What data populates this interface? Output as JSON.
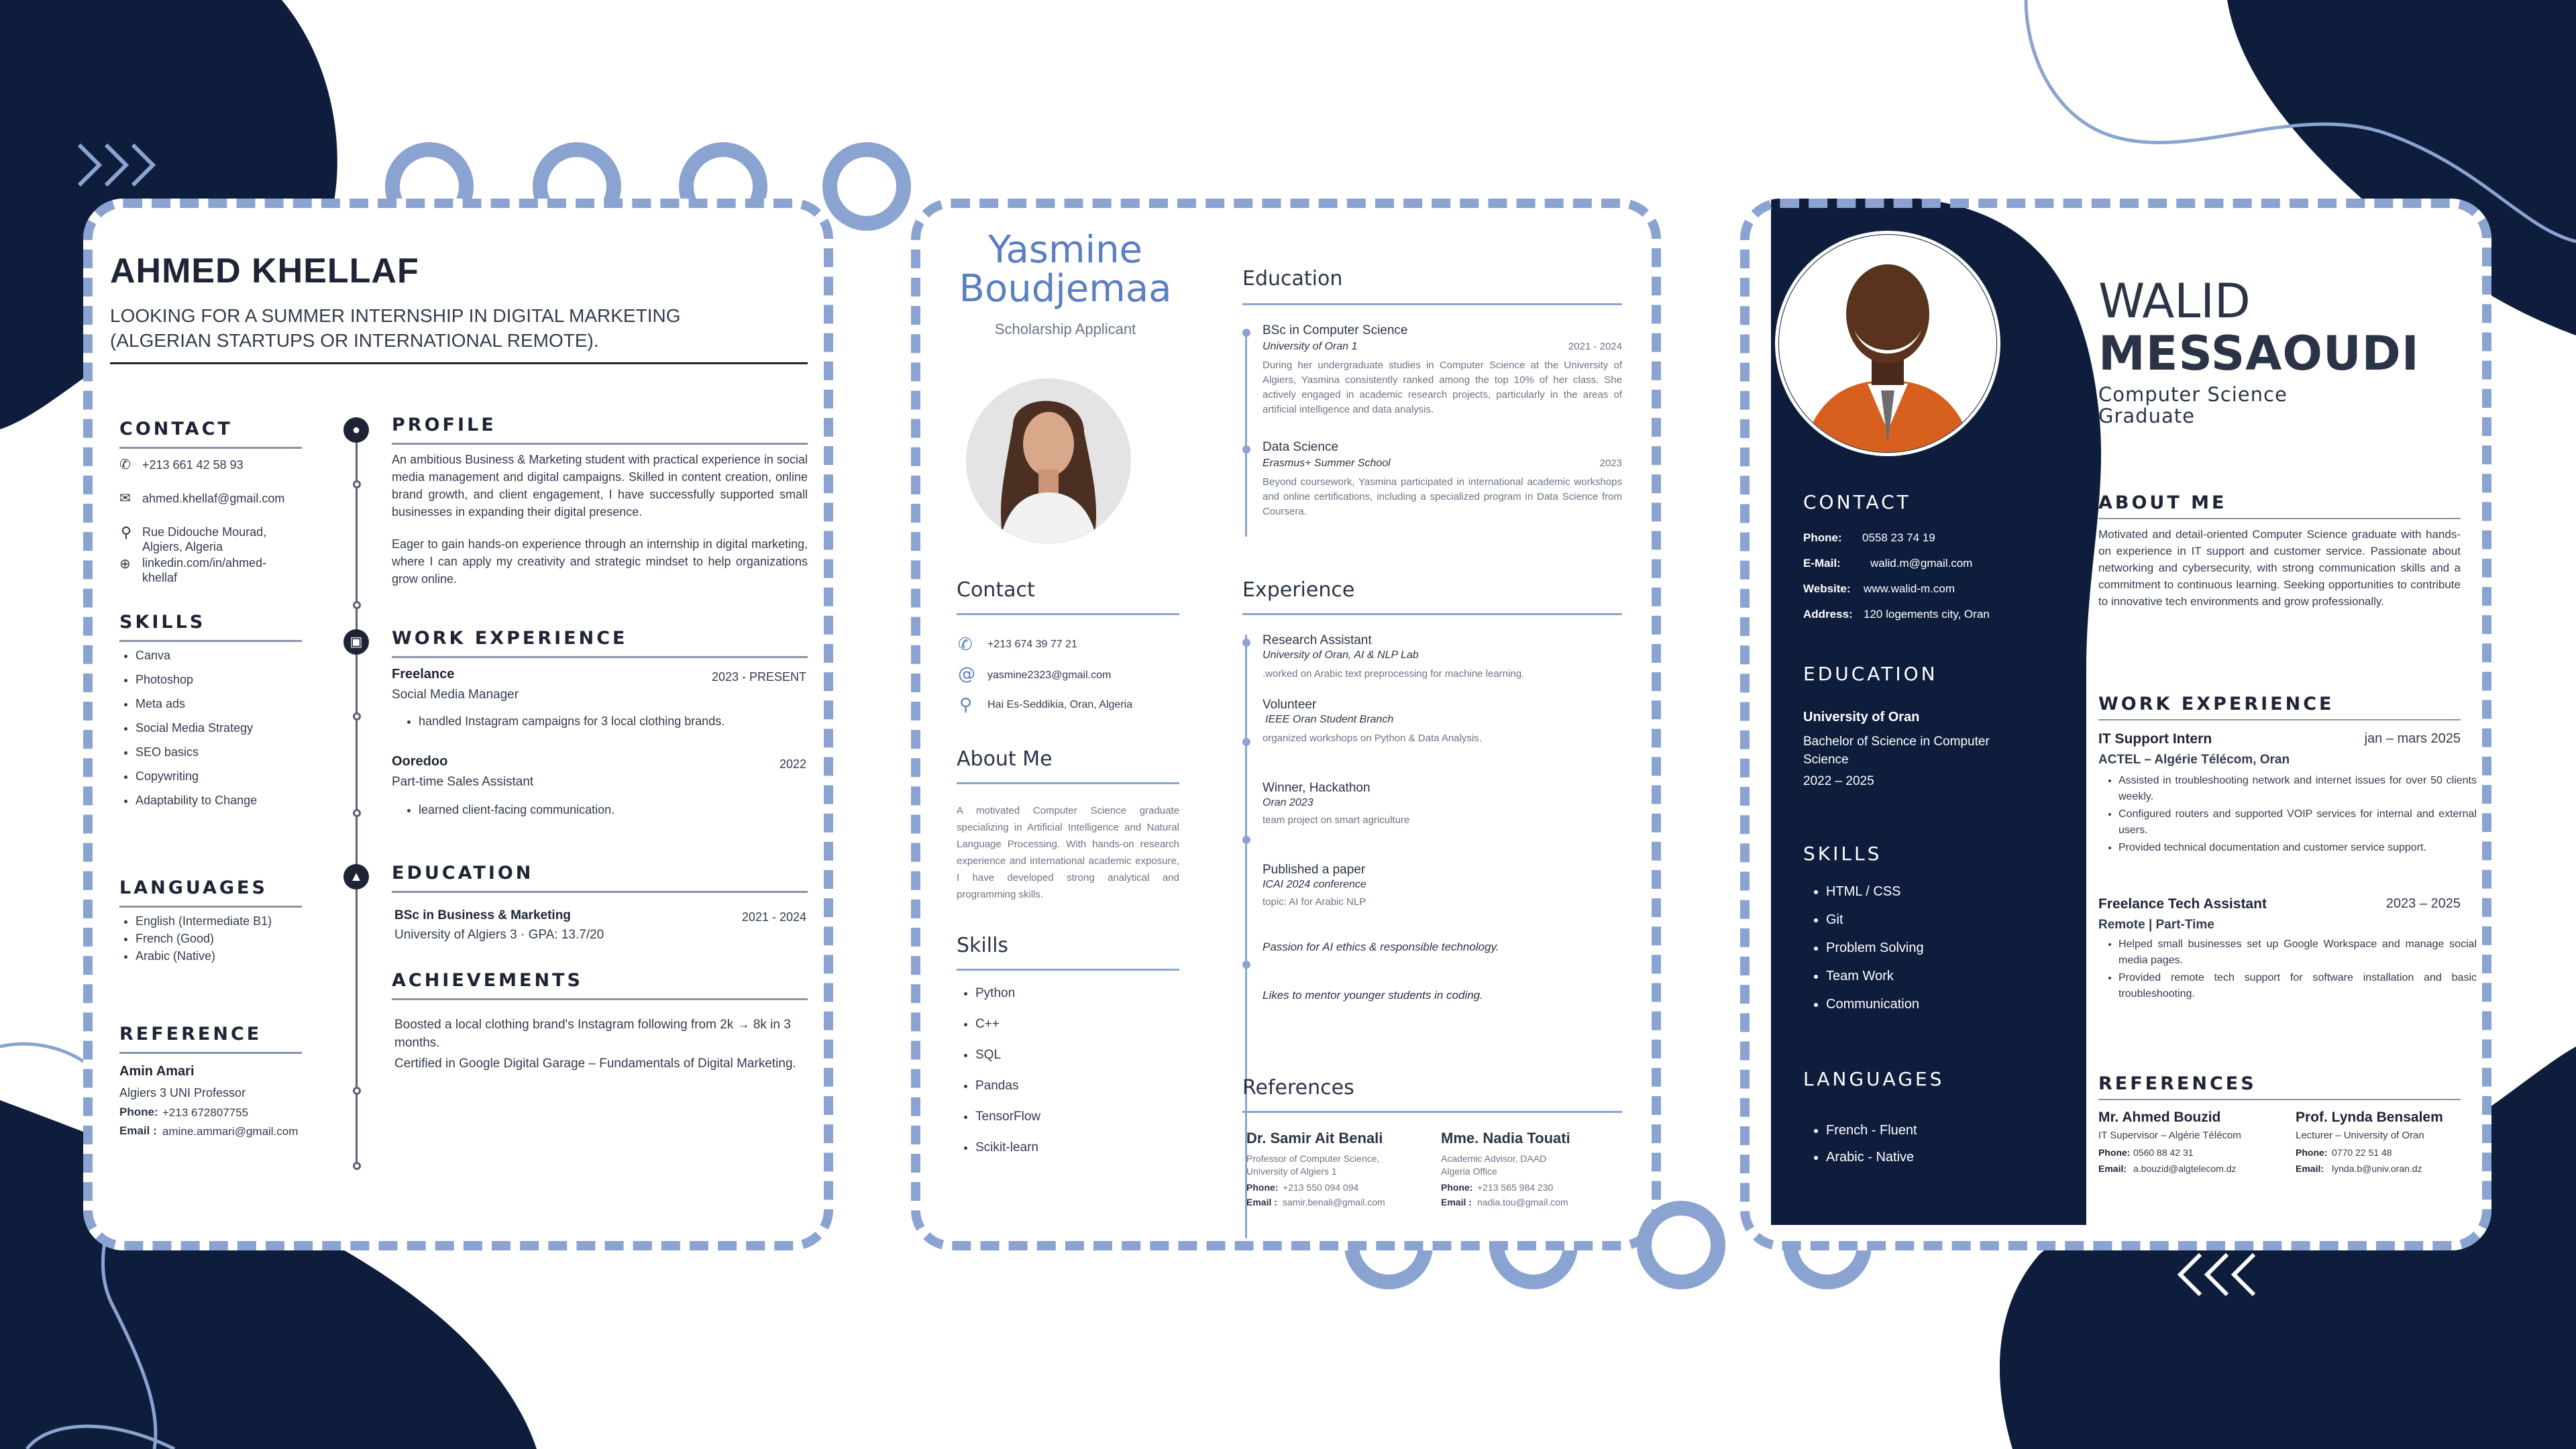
{
  "colors": {
    "navy": "#0f1d3d",
    "accent": "#8aa3d0",
    "blue": "#5b7fc0",
    "text": "#333b4d"
  },
  "cv1": {
    "name": "AHMED KHELLAF",
    "objective": "LOOKING FOR A SUMMER INTERNSHIP IN DIGITAL MARKETING (ALGERIAN STARTUPS OR INTERNATIONAL REMOTE).",
    "contact_title": "CONTACT",
    "contact": {
      "phone": "+213 661 42 58 93",
      "email": "ahmed.khellaf@gmail.com",
      "address": "Rue Didouche Mourad, Algiers, Algeria",
      "web": "linkedin.com/in/ahmed-khellaf"
    },
    "skills_title": "SKILLS",
    "skills": [
      "Canva",
      "Photoshop",
      "Meta ads",
      "Social Media Strategy",
      "SEO basics",
      "Copywriting",
      "Adaptability to Change"
    ],
    "languages_title": "LANGUAGES",
    "languages": [
      "English (Intermediate B1)",
      "French (Good)",
      "Arabic (Native)"
    ],
    "reference_title": "REFERENCE",
    "reference": {
      "name": "Amin Amari",
      "role": "Algiers 3 UNI Professor",
      "phone_label": "Phone:",
      "phone": "+213 672807755",
      "email_label": "Email :",
      "email": "amine.ammari@gmail.com"
    },
    "profile_title": "PROFILE",
    "profile_p1": "An ambitious Business & Marketing student with practical experience in social media management and digital campaigns. Skilled in content creation, online brand growth, and client engagement, I have successfully supported small businesses in expanding their digital presence.",
    "profile_p2": "Eager to gain hands-on experience through an internship in digital marketing, where I can apply my creativity and strategic mindset to help organizations grow online.",
    "work_title": "WORK EXPERIENCE",
    "jobs": [
      {
        "company": "Freelance",
        "date": "2023 - PRESENT",
        "role": "Social Media Manager",
        "bullet": "handled Instagram campaigns for 3 local clothing brands."
      },
      {
        "company": "Ooredoo",
        "date": "2022",
        "role": "Part-time Sales Assistant",
        "bullet": "learned client-facing communication."
      }
    ],
    "education_title": "EDUCATION",
    "education": {
      "degree": "BSc in Business & Marketing",
      "date": "2021 - 2024",
      "school": "University of Algiers 3 · GPA: 13.7/20"
    },
    "achievements_title": "ACHIEVEMENTS",
    "achievements": [
      "Boosted a local clothing brand's Instagram following from 2k → 8k in 3 months.",
      "Certified in Google Digital Garage – Fundamentals of Digital Marketing."
    ]
  },
  "cv2": {
    "first_name": "Yasmine",
    "last_name": "Boudjemaa",
    "subtitle": "Scholarship Applicant",
    "contact_title": "Contact",
    "contact": {
      "phone": "+213 674 39 77 21",
      "email": "yasmine2323@gmail.com",
      "address": "Hai Es-Seddikia, Oran, Algeria"
    },
    "about_title": "About Me",
    "about": "A motivated Computer Science graduate specializing in Artificial Intelligence and Natural Language Processing. With hands-on research experience and international academic exposure, I have developed strong analytical and programming skills.",
    "skills_title": "Skills",
    "skills": [
      "Python",
      "C++",
      "SQL",
      "Pandas",
      "TensorFlow",
      "Scikit-learn"
    ],
    "education_title": "Education",
    "education": [
      {
        "title": "BSc in Computer Science",
        "sub": "University of Oran 1",
        "date": "2021 - 2024",
        "desc": "During her undergraduate studies in Computer Science at the University of Algiers, Yasmina consistently ranked among the top 10% of her class. She actively engaged in academic research projects, particularly in the areas of artificial intelligence and data analysis."
      },
      {
        "title": "Data Science",
        "sub": "Erasmus+ Summer School",
        "date": "2023",
        "desc": "Beyond coursework, Yasmina participated in international academic workshops and online certifications, including a specialized program in Data Science from Coursera."
      }
    ],
    "experience_title": "Experience",
    "experience": [
      {
        "title": "Research Assistant",
        "sub": "University of Oran, AI & NLP Lab",
        "desc": ".worked on Arabic text preprocessing for machine learning."
      },
      {
        "title": "Volunteer",
        "sub": "IEEE Oran Student Branch",
        "desc": "organized workshops on Python & Data Analysis."
      },
      {
        "title": "Winner, Hackathon",
        "sub": "Oran 2023",
        "desc": "team project on smart agriculture"
      },
      {
        "title": "Published a paper",
        "sub": "ICAI 2024 conference",
        "desc": "topic: AI for Arabic NLP"
      }
    ],
    "passion1": "Passion for AI ethics & responsible technology.",
    "passion2": "Likes to mentor younger students in coding.",
    "references_title": "References",
    "references": [
      {
        "name": "Dr. Samir Ait Benali",
        "role": "Professor of Computer Science, University of Algiers 1",
        "phone_label": "Phone:",
        "phone": "+213 550 094 094",
        "email_label": "Email :",
        "email": "samir.benali@gmail.com"
      },
      {
        "name": "Mme. Nadia Touati",
        "role": "Academic Advisor, DAAD Algeria Office",
        "phone_label": "Phone:",
        "phone": "+213 565 984 230",
        "email_label": "Email :",
        "email": "nadia.tou@gmail.com"
      }
    ]
  },
  "cv3": {
    "first_name": "WALID",
    "last_name": "MESSAOUDI",
    "subtitle": "Computer Science Graduate",
    "contact_title": "CONTACT",
    "contact": [
      {
        "label": "Phone:",
        "value": "0558 23 74 19"
      },
      {
        "label": "E-Mail:",
        "value": "walid.m@gmail.com"
      },
      {
        "label": "Website:",
        "value": "www.walid-m.com"
      },
      {
        "label": "Address:",
        "value": "120 logements city, Oran"
      }
    ],
    "education_title": "EDUCATION",
    "education": {
      "school": "University of Oran",
      "degree": "Bachelor of Science in Computer Science",
      "date": "2022 – 2025"
    },
    "skills_title": "SKILLS",
    "skills": [
      "HTML / CSS",
      "Git",
      "Problem Solving",
      "Team Work",
      "Communication"
    ],
    "languages_title": "LANGUAGES",
    "languages": [
      "French - Fluent",
      "Arabic - Native"
    ],
    "about_title": "ABOUT ME",
    "about": "Motivated and detail-oriented Computer Science graduate with hands-on experience in IT support and customer service. Passionate about networking and cybersecurity, with strong communication skills and a commitment to continuous learning. Seeking opportunities to contribute to innovative tech environments and grow professionally.",
    "work_title": "WORK EXPERIENCE",
    "jobs": [
      {
        "title": "IT Support Intern",
        "date": "jan – mars 2025",
        "company": "ACTEL – Algérie Télécom, Oran",
        "bullets": [
          "Assisted in troubleshooting network and internet issues for over 50 clients weekly.",
          "Configured routers and supported VOIP services for internal and external users.",
          "Provided technical documentation and customer service support."
        ]
      },
      {
        "title": "Freelance Tech Assistant",
        "date": "2023 – 2025",
        "company": "Remote | Part-Time",
        "bullets": [
          "Helped small businesses set up Google Workspace and manage social media pages.",
          "Provided remote tech support for software installation and basic troubleshooting."
        ]
      }
    ],
    "references_title": "REFERENCES",
    "references": [
      {
        "name": "Mr. Ahmed Bouzid",
        "role": "IT Supervisor – Algérie Télécom",
        "phone_label": "Phone:",
        "phone": "0560 88 42 31",
        "email_label": "Email:",
        "email": "a.bouzid@algtelecom.dz"
      },
      {
        "name": "Prof. Lynda Bensalem",
        "role": "Lecturer – University of Oran",
        "phone_label": "Phone:",
        "phone": "0770 22 51 48",
        "email_label": "Email:",
        "email": "lynda.b@univ.oran.dz"
      }
    ]
  }
}
